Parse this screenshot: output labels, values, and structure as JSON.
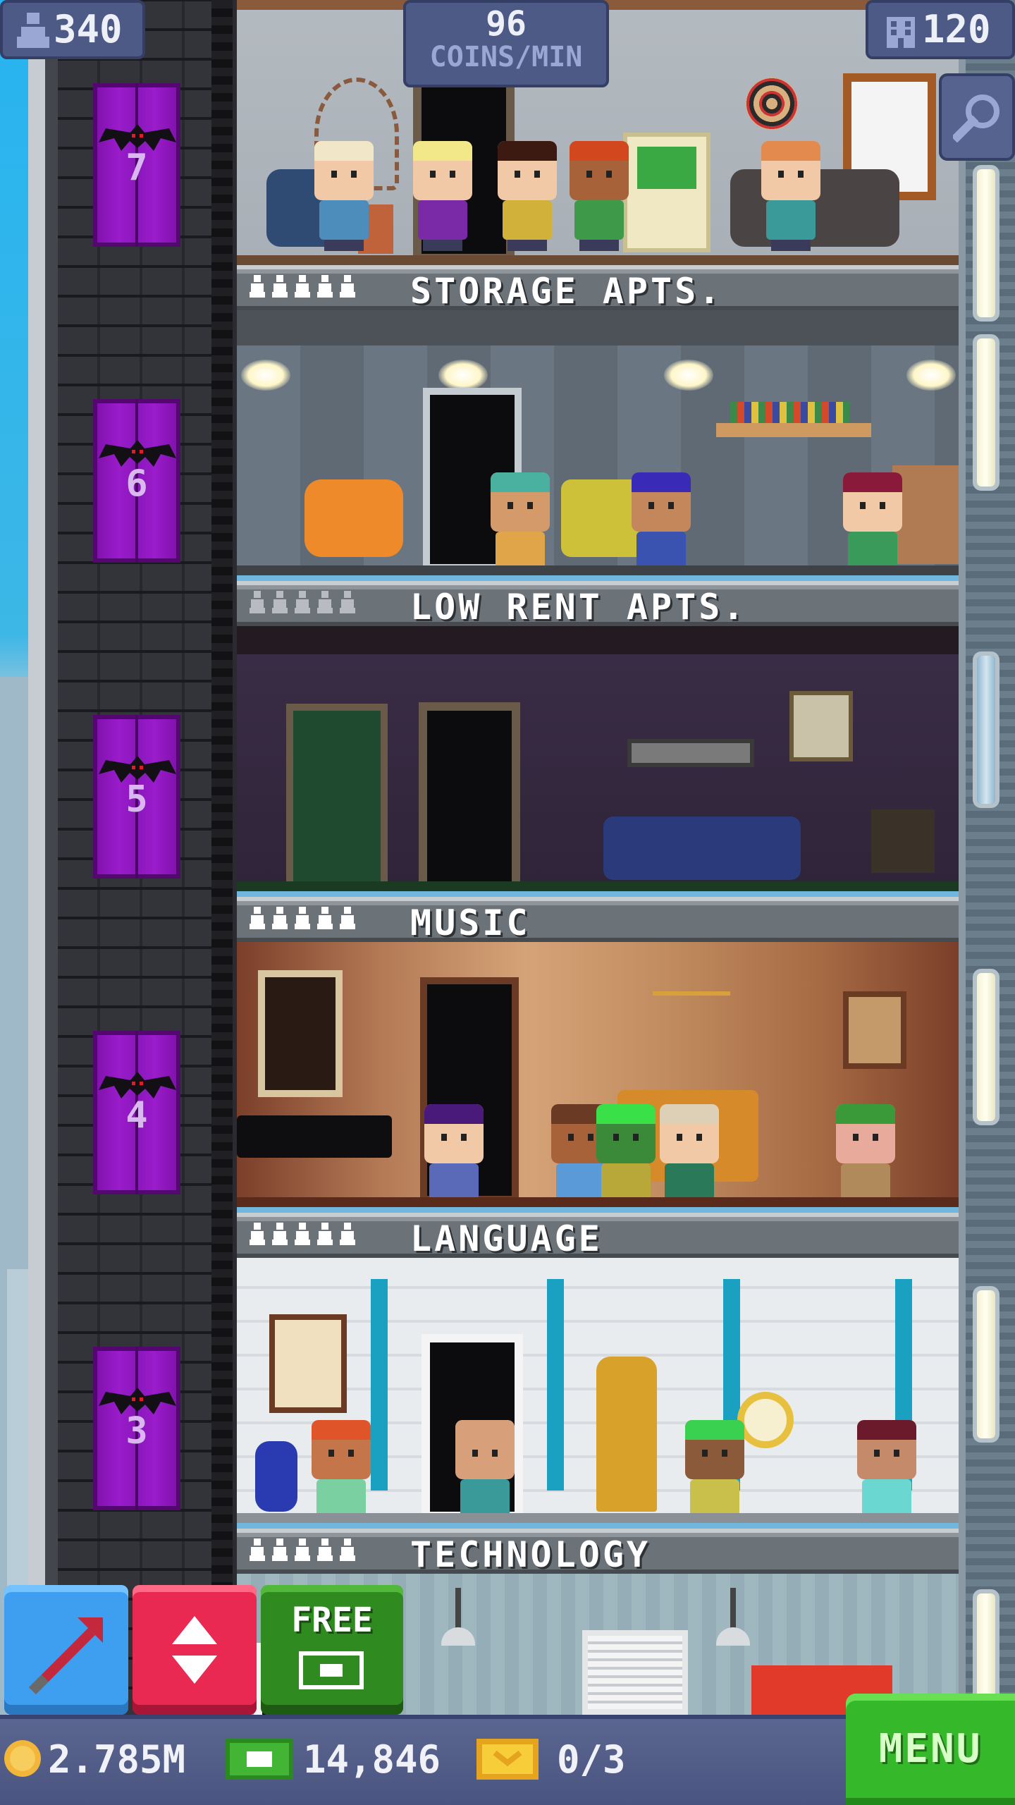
{
  "hud": {
    "population": "340",
    "coins_per_min_value": "96",
    "coins_per_min_unit": "COINS/MIN",
    "floor_count": "120"
  },
  "elevator": {
    "floor_numbers": [
      "7",
      "6",
      "5",
      "4",
      "3"
    ]
  },
  "floors": [
    {
      "name": "STORAGE APTS."
    },
    {
      "name": "LOW RENT APTS."
    },
    {
      "name": "MUSIC"
    },
    {
      "name": "LANGUAGE"
    },
    {
      "name": "TECHNOLOGY"
    }
  ],
  "actions": {
    "free_label": "FREE"
  },
  "status": {
    "coins": "2.785M",
    "bux": "14,846",
    "tickets": "0/3"
  },
  "menu_label": "MENU",
  "colors": {
    "elevator_purple": "#9a1ccc",
    "menu_green": "#35b82a",
    "hud_blue": "#4e5a86",
    "arrow_button_blue": "#3e9ff0",
    "elevator_button_red": "#ea2952",
    "free_button_green": "#2f8a1f"
  },
  "icons": [
    "person-icon",
    "building-icon",
    "magnifier-icon",
    "bat-icon",
    "arrow-icon",
    "elevator-up-down-icon",
    "bux-icon",
    "coin-icon",
    "ticket-icon"
  ]
}
